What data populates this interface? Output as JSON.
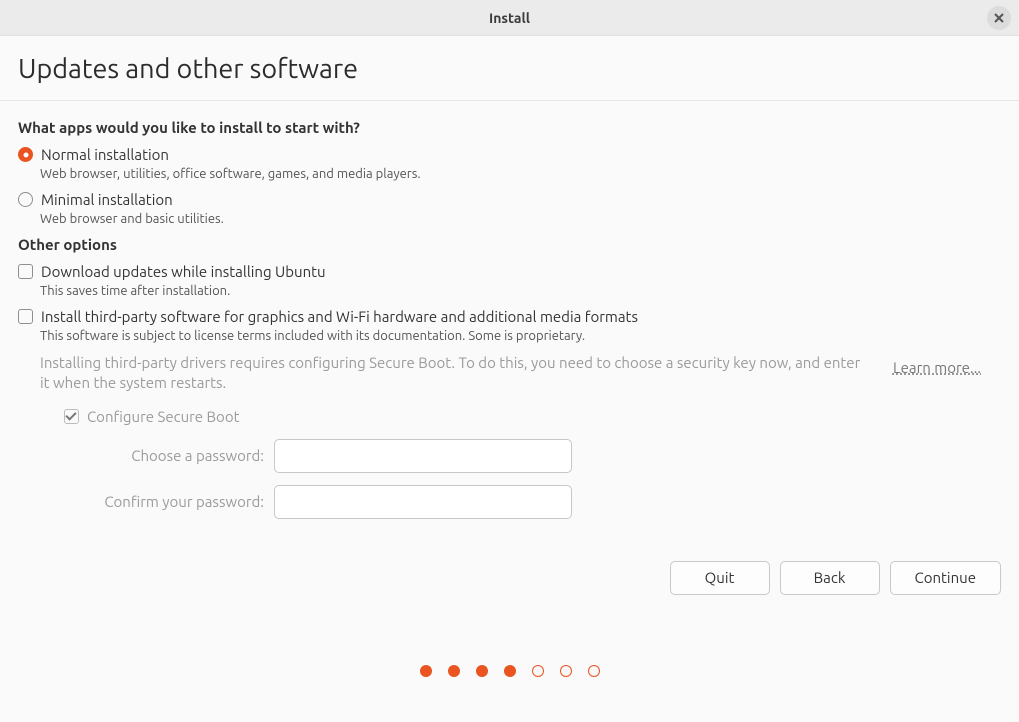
{
  "window": {
    "title": "Install"
  },
  "heading": "Updates and other software",
  "apps_section": {
    "title": "What apps would you like to install to start with?",
    "options": [
      {
        "label": "Normal installation",
        "desc": "Web browser, utilities, office software, games, and media players.",
        "selected": true
      },
      {
        "label": "Minimal installation",
        "desc": "Web browser and basic utilities.",
        "selected": false
      }
    ]
  },
  "other_section": {
    "title": "Other options",
    "download_updates": {
      "label": "Download updates while installing Ubuntu",
      "desc": "This saves time after installation.",
      "checked": false
    },
    "third_party": {
      "label": "Install third-party software for graphics and Wi-Fi hardware and additional media formats",
      "desc": "This software is subject to license terms included with its documentation. Some is proprietary.",
      "checked": false
    },
    "secure_boot": {
      "info": "Installing third-party drivers requires configuring Secure Boot. To do this, you need to choose a security key now, and enter it when the system restarts.",
      "learn_more": "Learn more...",
      "configure_label": "Configure Secure Boot",
      "configure_checked": true,
      "choose_pw_label": "Choose a password:",
      "confirm_pw_label": "Confirm your password:",
      "choose_pw_value": "",
      "confirm_pw_value": ""
    }
  },
  "buttons": {
    "quit": "Quit",
    "back": "Back",
    "continue": "Continue"
  },
  "progress": {
    "total": 7,
    "current": 4
  }
}
